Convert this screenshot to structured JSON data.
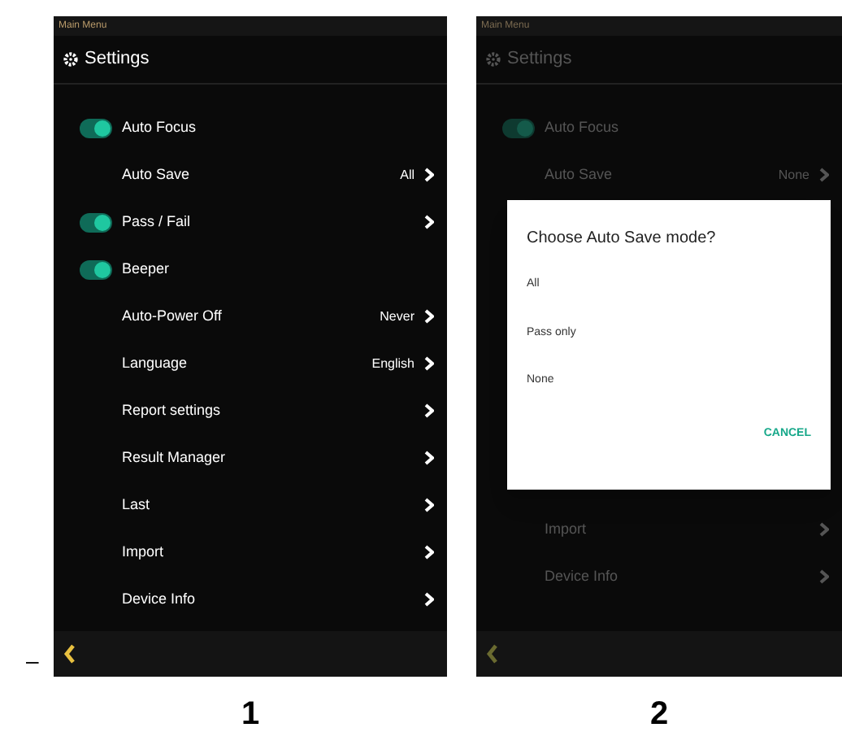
{
  "figure_dash": "–",
  "screens": [
    {
      "caption": "1",
      "status_title": "Main Menu",
      "header": {
        "title": "Settings"
      },
      "items": [
        {
          "kind": "toggle",
          "label": "Auto Focus",
          "on": true
        },
        {
          "kind": "link",
          "label": "Auto Save",
          "value": "All"
        },
        {
          "kind": "toggle",
          "label": "Pass / Fail",
          "on": true,
          "chevron": true
        },
        {
          "kind": "toggle",
          "label": "Beeper",
          "on": true
        },
        {
          "kind": "link",
          "label": "Auto-Power Off",
          "value": "Never"
        },
        {
          "kind": "link",
          "label": "Language",
          "value": "English"
        },
        {
          "kind": "link",
          "label": "Report settings"
        },
        {
          "kind": "link",
          "label": "Result Manager"
        },
        {
          "kind": "link",
          "label": "Last"
        },
        {
          "kind": "link",
          "label": "Import"
        },
        {
          "kind": "link",
          "label": "Device Info"
        }
      ]
    },
    {
      "caption": "2",
      "status_title": "Main Menu",
      "header": {
        "title": "Settings"
      },
      "items": [
        {
          "kind": "toggle",
          "label": "Auto Focus",
          "on": true
        },
        {
          "kind": "link",
          "label": "Auto Save",
          "value": "None"
        },
        {
          "kind": "gap"
        },
        {
          "kind": "link",
          "label": "Import"
        },
        {
          "kind": "link",
          "label": "Device Info"
        }
      ],
      "dialog": {
        "title": "Choose Auto Save mode?",
        "options": [
          "All",
          "Pass only",
          "None"
        ],
        "button": "CANCEL"
      }
    }
  ]
}
